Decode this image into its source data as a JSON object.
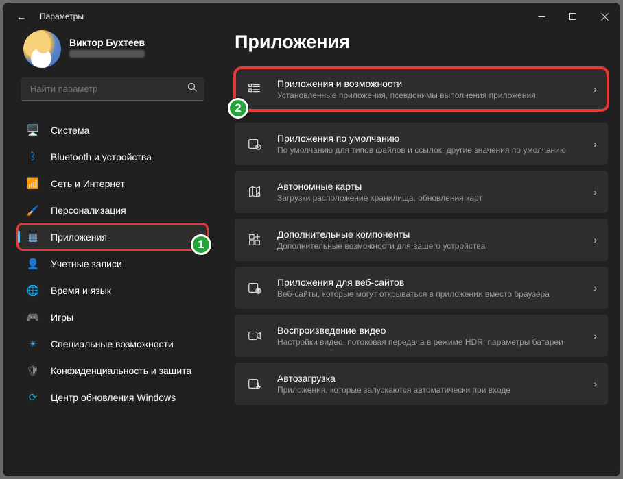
{
  "window": {
    "title": "Параметры"
  },
  "profile": {
    "name": "Виктор Бухтеев"
  },
  "search": {
    "placeholder": "Найти параметр"
  },
  "nav": [
    {
      "label": "Система",
      "icon": "🖥️",
      "color": "#3aa0ea"
    },
    {
      "label": "Bluetooth и устройства",
      "icon": "ᛒ",
      "color": "#3aa0ea"
    },
    {
      "label": "Сеть и Интернет",
      "icon": "📶",
      "color": "#2fb0d0"
    },
    {
      "label": "Персонализация",
      "icon": "🖌️",
      "color": "#d07a3a"
    },
    {
      "label": "Приложения",
      "icon": "▦",
      "color": "#7aa4d0",
      "selected": true,
      "marker": 1
    },
    {
      "label": "Учетные записи",
      "icon": "👤",
      "color": "#34b26a"
    },
    {
      "label": "Время и язык",
      "icon": "🌐",
      "color": "#3a8ed0"
    },
    {
      "label": "Игры",
      "icon": "🎮",
      "color": "#7a7a7a"
    },
    {
      "label": "Специальные возможности",
      "icon": "✴",
      "color": "#3aa0ea"
    },
    {
      "label": "Конфиденциальность и защита",
      "icon": "🛡",
      "color": "#8a8a8a"
    },
    {
      "label": "Центр обновления Windows",
      "icon": "⟳",
      "color": "#2fb0d0"
    }
  ],
  "page": {
    "title": "Приложения"
  },
  "cards": [
    {
      "title": "Приложения и возможности",
      "sub": "Установленные приложения, псевдонимы выполнения приложения",
      "icon": "list",
      "marker": 2
    },
    {
      "title": "Приложения по умолчанию",
      "sub": "По умолчанию для типов файлов и ссылок, другие значения по умолчанию",
      "icon": "defaults"
    },
    {
      "title": "Автономные карты",
      "sub": "Загрузки расположение хранилища, обновления карт",
      "icon": "maps"
    },
    {
      "title": "Дополнительные компоненты",
      "sub": "Дополнительные возможности для вашего устройства",
      "icon": "features"
    },
    {
      "title": "Приложения для веб-сайтов",
      "sub": "Веб-сайты, которые могут открываться в приложении вместо браузера",
      "icon": "web"
    },
    {
      "title": "Воспроизведение видео",
      "sub": "Настройки видео, потоковая передача в режиме HDR, параметры батареи",
      "icon": "video"
    },
    {
      "title": "Автозагрузка",
      "sub": "Приложения, которые запускаются автоматически при входе",
      "icon": "startup"
    }
  ],
  "markers": {
    "1": "1",
    "2": "2"
  }
}
